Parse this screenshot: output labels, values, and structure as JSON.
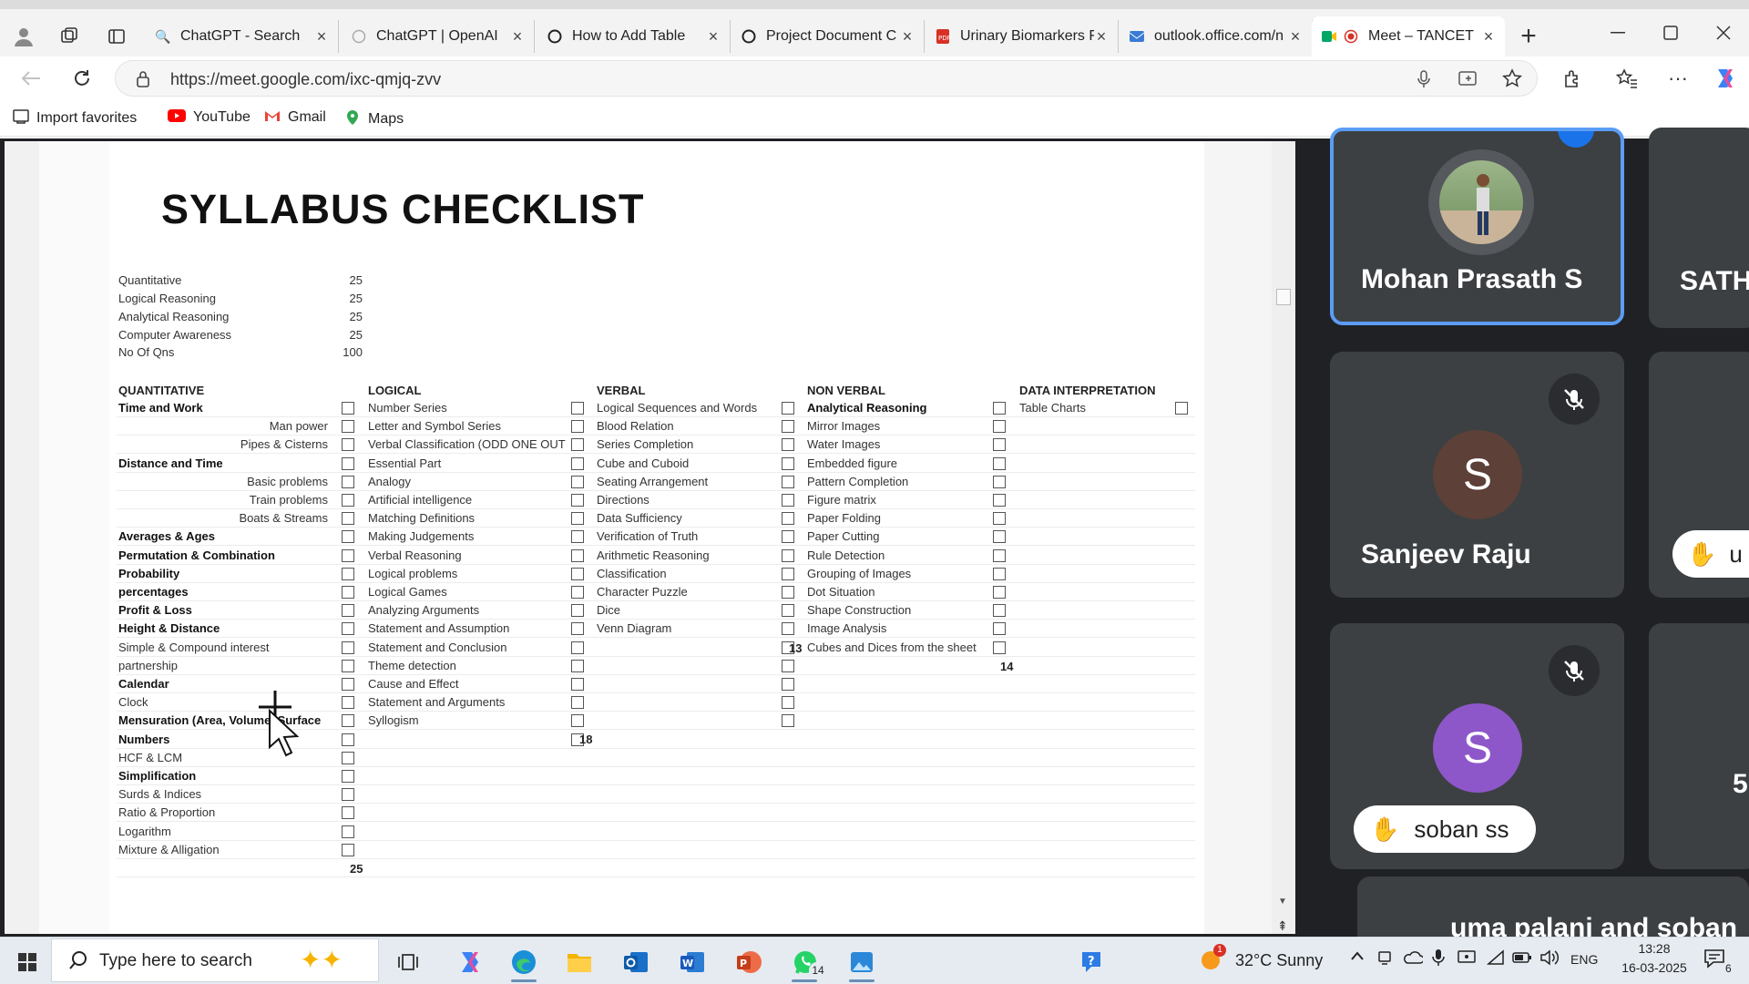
{
  "browser": {
    "tabs": [
      {
        "title": "ChatGPT - Search"
      },
      {
        "title": "ChatGPT | OpenAI"
      },
      {
        "title": "How to Add Table"
      },
      {
        "title": "Project Document C"
      },
      {
        "title": "Urinary Biomarkers F"
      },
      {
        "title": "outlook.office.com/n"
      },
      {
        "title": "Meet – TANCET"
      }
    ],
    "new_tab": "+",
    "url": "https://meet.google.com/ixc-qmjq-zvv",
    "bookmarks": [
      {
        "label": "Import favorites"
      },
      {
        "label": "YouTube"
      },
      {
        "label": "Gmail"
      },
      {
        "label": "Maps"
      }
    ]
  },
  "document": {
    "title": "SYLLABUS CHECKLIST",
    "summary": [
      {
        "label": "Quantitative",
        "value": "25"
      },
      {
        "label": "Logical Reasoning",
        "value": "25"
      },
      {
        "label": "Analytical Reasoning",
        "value": "25"
      },
      {
        "label": "Computer Awareness",
        "value": "25"
      },
      {
        "label": "No Of Qns",
        "value": "100"
      }
    ],
    "columns": {
      "quantitative": {
        "heading": "QUANTITATIVE",
        "items": [
          "Time and Work",
          "Man power",
          "Pipes & Cisterns",
          "Distance and Time",
          "Basic problems",
          "Train problems",
          "Boats & Streams",
          "Averages & Ages",
          "Permutation & Combination",
          "Probability",
          "percentages",
          "Profit & Loss",
          "Height & Distance",
          "Simple & Compound interest",
          "partnership",
          "Calendar",
          "Clock",
          "Mensuration (Area, Volume, Surface",
          "Numbers",
          "HCF & LCM",
          "Simplification",
          "Surds & Indices",
          "Ratio & Proportion",
          "Logarithm",
          "Mixture & Alligation"
        ],
        "total": "25"
      },
      "logical": {
        "heading": "LOGICAL",
        "items": [
          "Number Series",
          "Letter and Symbol Series",
          "Verbal Classification (ODD ONE OUT",
          "Essential Part",
          "Analogy",
          "Artificial intelligence",
          "Matching Definitions",
          "Making Judgements",
          "Verbal Reasoning",
          "Logical problems",
          "Logical Games",
          "Analyzing Arguments",
          "Statement and Assumption",
          "Statement and Conclusion",
          "Theme detection",
          "Cause and Effect",
          "Statement and Arguments",
          "Syllogism"
        ],
        "total": "18"
      },
      "verbal": {
        "heading": "VERBAL",
        "items": [
          "Logical Sequences and Words",
          "Blood Relation",
          "Series Completion",
          "Cube and Cuboid",
          "Seating Arrangement",
          "Directions",
          "Data Sufficiency",
          "Verification of Truth",
          "Arithmetic Reasoning",
          "Classification",
          "Character Puzzle",
          "Dice",
          "Venn Diagram"
        ],
        "total": "13"
      },
      "nonverbal": {
        "heading": "NON VERBAL",
        "items": [
          "Analytical Reasoning",
          "Mirror Images",
          "Water Images",
          "Embedded figure",
          "Pattern Completion",
          "Figure matrix",
          "Paper Folding",
          "Paper Cutting",
          "Rule Detection",
          "Grouping of Images",
          "Dot Situation",
          "Shape Construction",
          "Image Analysis",
          "Cubes and Dices from the sheet"
        ],
        "total": "14"
      },
      "data_interpretation": {
        "heading": "DATA INTERPRETATION",
        "items": [
          "Table Charts"
        ]
      }
    }
  },
  "participants": [
    {
      "name": "Mohan Prasath S",
      "avatar": "photo"
    },
    {
      "name": "SATH"
    },
    {
      "name": "Sanjeev Raju",
      "initial": "S",
      "color": "#5d4037"
    },
    {
      "name": "u"
    },
    {
      "name": "soban ss",
      "initial": "S",
      "color": "#8e57c9"
    },
    {
      "name": "5"
    },
    {
      "name": "uma palani and soban"
    }
  ],
  "taskbar": {
    "search_placeholder": "Type here to search",
    "whatsapp_badge": "14",
    "weather": "32°C  Sunny",
    "weather_alert": "1",
    "lang": "ENG",
    "time": "13:28",
    "date": "16-03-2025",
    "notifications": "6"
  },
  "colors": {
    "accent_blue": "#1a73e8",
    "meet_bg": "#202124",
    "tile_bg": "#3c4043"
  }
}
